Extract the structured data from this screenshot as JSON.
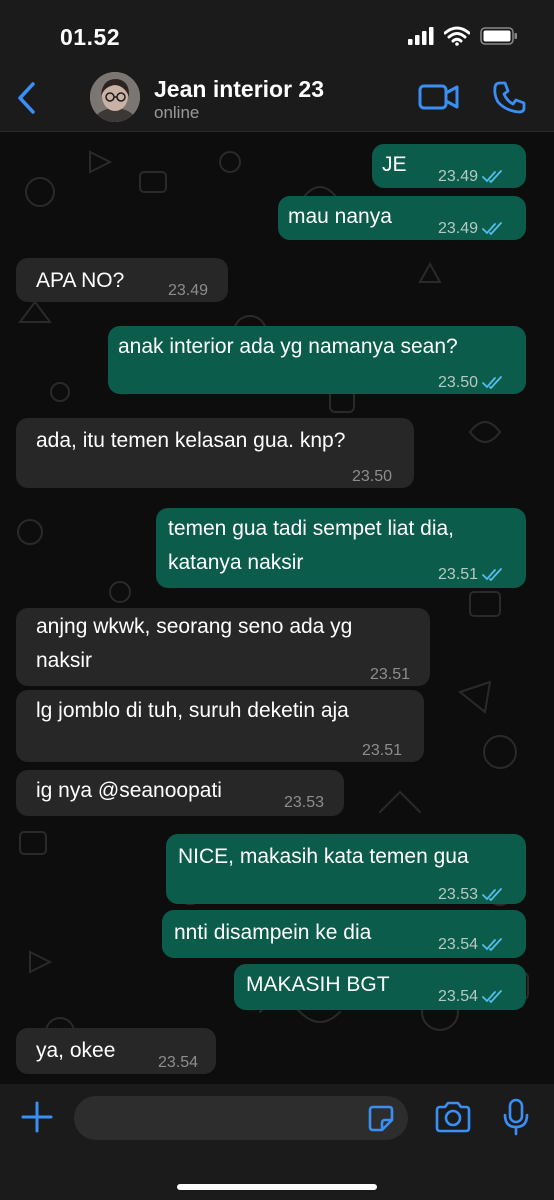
{
  "status_bar": {
    "time": "01.52"
  },
  "header": {
    "contact_name": "Jean interior 23",
    "contact_status": "online"
  },
  "messages": [
    {
      "direction": "out",
      "lines": [
        "JE"
      ],
      "time": "23.49",
      "read": true
    },
    {
      "direction": "out",
      "lines": [
        "mau nanya"
      ],
      "time": "23.49",
      "read": true
    },
    {
      "direction": "in",
      "lines": [
        "APA NO?"
      ],
      "time": "23.49"
    },
    {
      "direction": "out",
      "lines": [
        "anak interior ada yg namanya sean?"
      ],
      "time": "23.50",
      "read": true
    },
    {
      "direction": "in",
      "lines": [
        "ada, itu temen kelasan gua. knp?"
      ],
      "time": "23.50"
    },
    {
      "direction": "out",
      "lines": [
        "temen gua tadi sempet liat dia,",
        "katanya naksir"
      ],
      "time": "23.51",
      "read": true
    },
    {
      "direction": "in",
      "lines": [
        "anjng wkwk, seorang seno ada yg",
        "naksir"
      ],
      "time": "23.51"
    },
    {
      "direction": "in",
      "lines": [
        "lg jomblo di tuh, suruh deketin aja"
      ],
      "time": "23.51"
    },
    {
      "direction": "in",
      "lines": [
        "ig nya @seanoopati"
      ],
      "time": "23.53"
    },
    {
      "direction": "out",
      "lines": [
        "NICE, makasih kata temen gua"
      ],
      "time": "23.53",
      "read": true
    },
    {
      "direction": "out",
      "lines": [
        "nnti disampein ke dia"
      ],
      "time": "23.54",
      "read": true
    },
    {
      "direction": "out",
      "lines": [
        "MAKASIH BGT"
      ],
      "time": "23.54",
      "read": true
    },
    {
      "direction": "in",
      "lines": [
        "ya, okee"
      ],
      "time": "23.54"
    }
  ],
  "input_bar": {
    "placeholder": ""
  },
  "colors": {
    "accent": "#3a8ff5",
    "outgoing_bubble": "#0b5c4b",
    "incoming_bubble": "#272727",
    "read_tick": "#53bdeb"
  },
  "icons": {
    "back": "chevron-left-icon",
    "video": "video-camera-icon",
    "call": "phone-icon",
    "attach": "plus-icon",
    "sticker": "sticker-icon",
    "camera": "camera-icon",
    "mic": "microphone-icon"
  }
}
